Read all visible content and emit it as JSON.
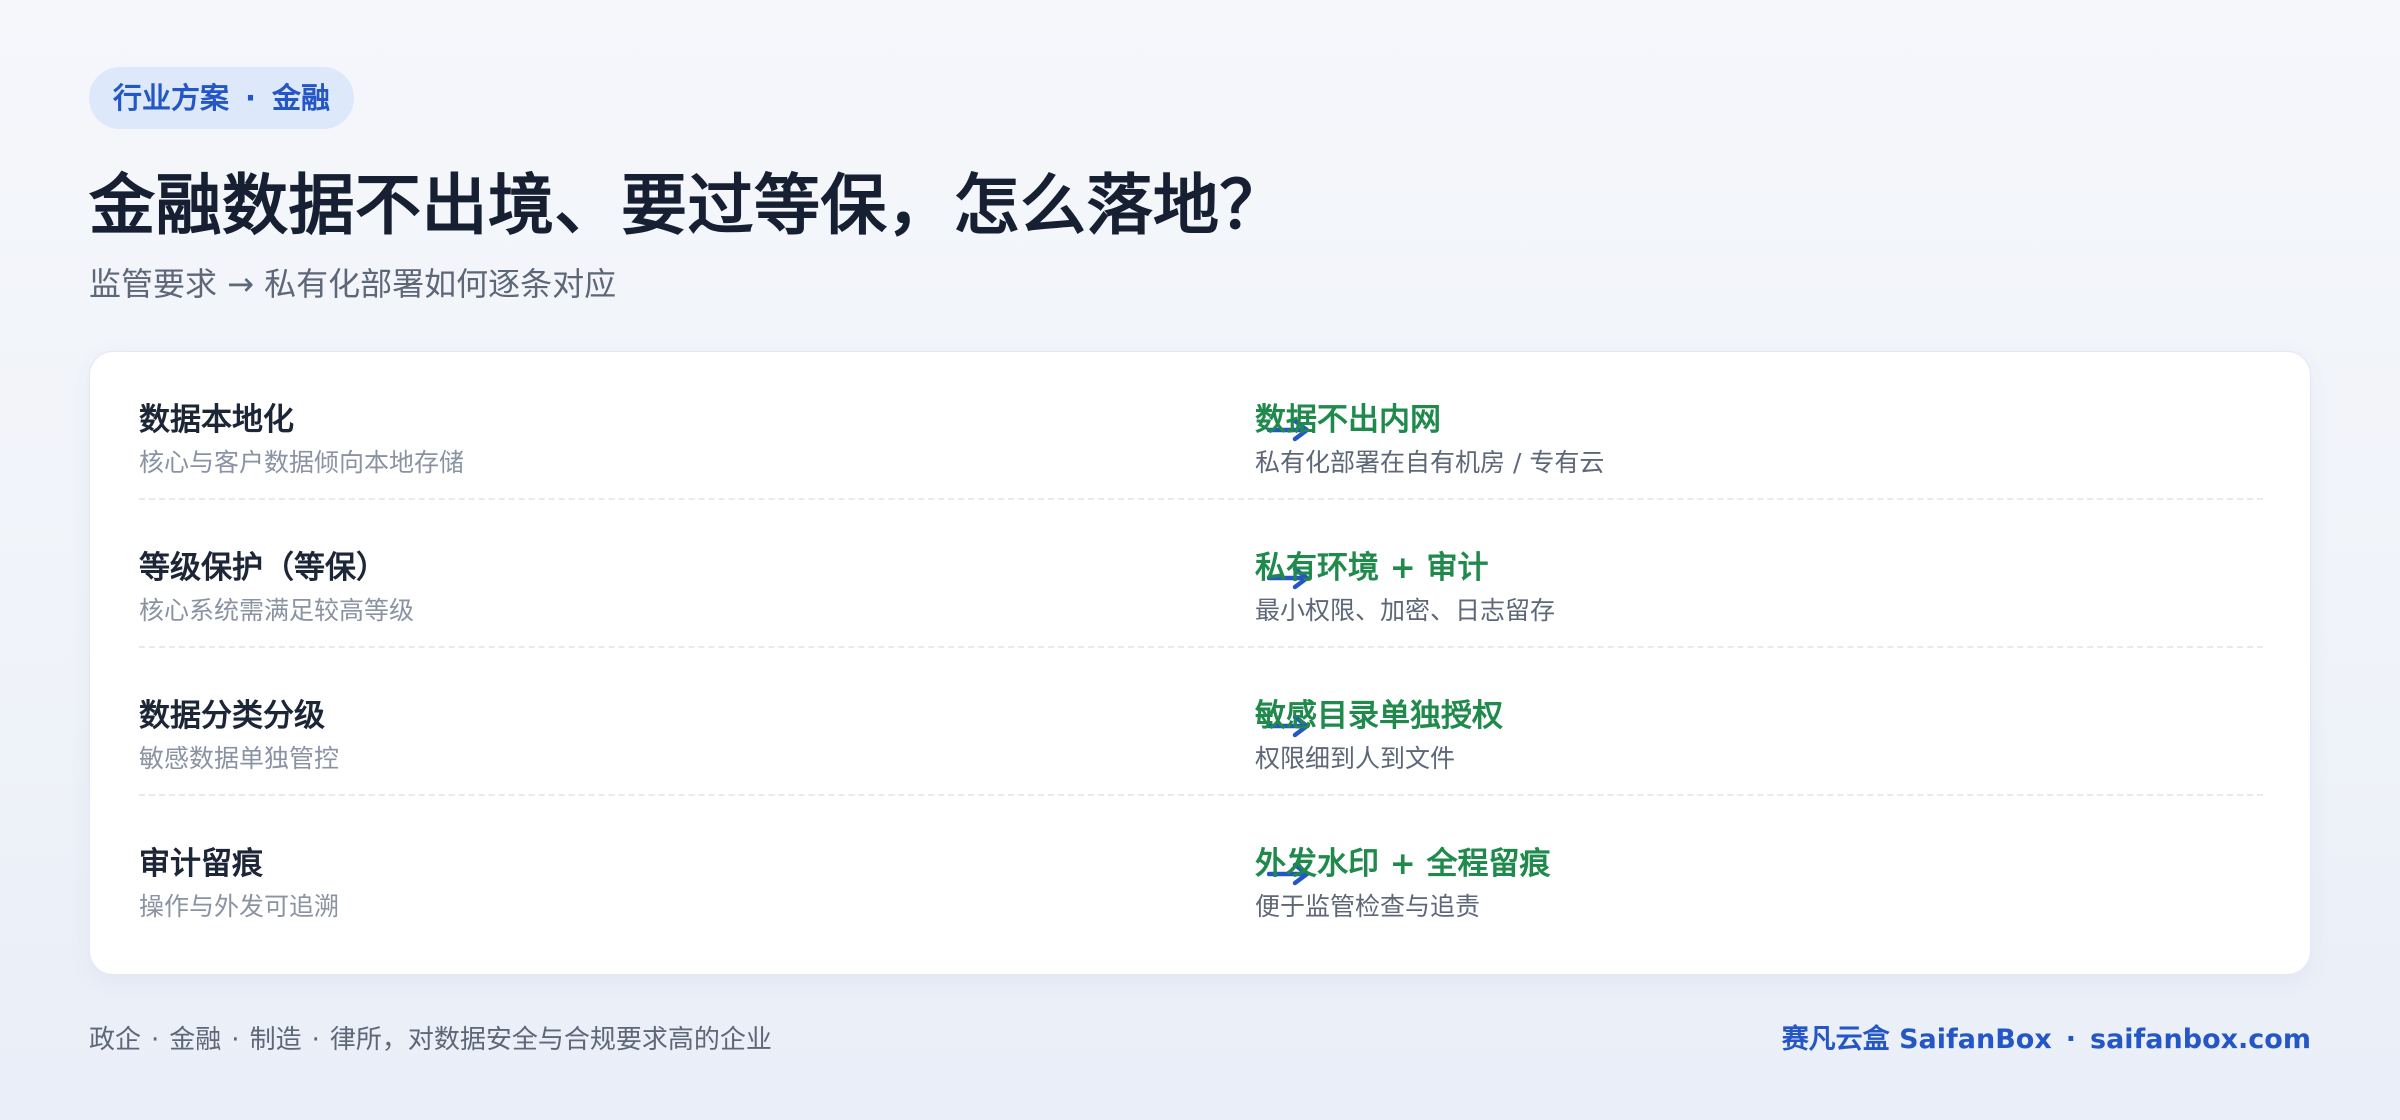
{
  "tag": {
    "category": "行业方案",
    "separator": "·",
    "industry": "金融"
  },
  "header": {
    "title": "金融数据不出境、要过等保，怎么落地？",
    "subtitle": "监管要求 → 私有化部署如何逐条对应"
  },
  "rows": [
    {
      "requirement_title": "数据本地化",
      "requirement_desc": "核心与客户数据倾向本地存储",
      "solution_title": "数据不出内网",
      "solution_desc": "私有化部署在自有机房 / 专有云"
    },
    {
      "requirement_title": "等级保护（等保）",
      "requirement_desc": "核心系统需满足较高等级",
      "solution_title": "私有环境 + 审计",
      "solution_desc": "最小权限、加密、日志留存"
    },
    {
      "requirement_title": "数据分类分级",
      "requirement_desc": "敏感数据单独管控",
      "solution_title": "敏感目录单独授权",
      "solution_desc": "权限细到人到文件"
    },
    {
      "requirement_title": "审计留痕",
      "requirement_desc": "操作与外发可追溯",
      "solution_title": "外发水印 + 全程留痕",
      "solution_desc": "便于监管检查与追责"
    }
  ],
  "footer": {
    "industries": [
      "政企",
      "金融",
      "制造",
      "律所"
    ],
    "separator": "·",
    "industries_suffix": "，对数据安全与合规要求高的企业",
    "brand": "赛凡云盒 SaifanBox",
    "site_separator": "·",
    "website": "saifanbox.com"
  },
  "colors": {
    "accent_blue": "#2457c5",
    "accent_green": "#1f8a4c",
    "tag_bg": "#dde8fb"
  },
  "icons": {
    "row_arrow": "right-arrow-icon"
  }
}
